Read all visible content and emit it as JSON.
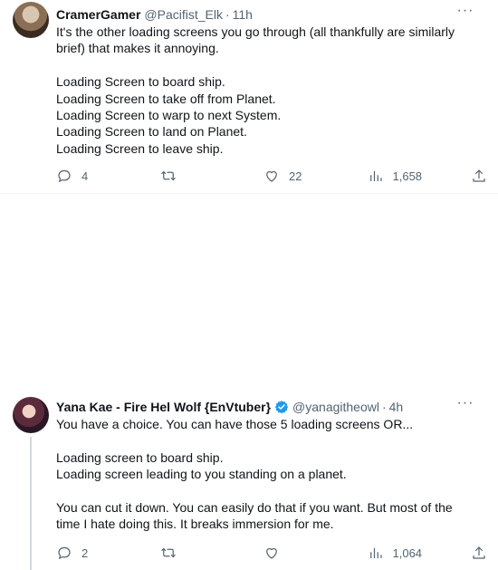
{
  "tweets": [
    {
      "name": "CramerGamer",
      "handle": "@Pacifist_Elk",
      "time": "11h",
      "body": "It's the other loading screens you go through (all thankfully are similarly\nbrief) that makes it annoying.\n\nLoading Screen to board ship.\nLoading Screen to take off from Planet.\nLoading Screen to warp to next System.\nLoading Screen to land on Planet.\nLoading Screen to leave ship.",
      "replies": "4",
      "retweets": "",
      "likes": "22",
      "views": "1,658"
    },
    {
      "name": "Yana Kae - Fire Hel Wolf {EnVtuber}",
      "handle": "@yanagitheowl",
      "time": "4h",
      "body": "You have a choice. You can have those 5 loading screens OR...\n\nLoading screen to board ship.\nLoading screen leading to you standing on a planet.\n\nYou can cut it down. You can easily do that if you want. But most of the\ntime I hate doing this. It breaks immersion for me.",
      "replies": "2",
      "retweets": "",
      "likes": "",
      "views": "1,064"
    }
  ],
  "colors": {
    "verified": "#1d9bf0",
    "muted": "#536471",
    "text": "#0f1419"
  }
}
